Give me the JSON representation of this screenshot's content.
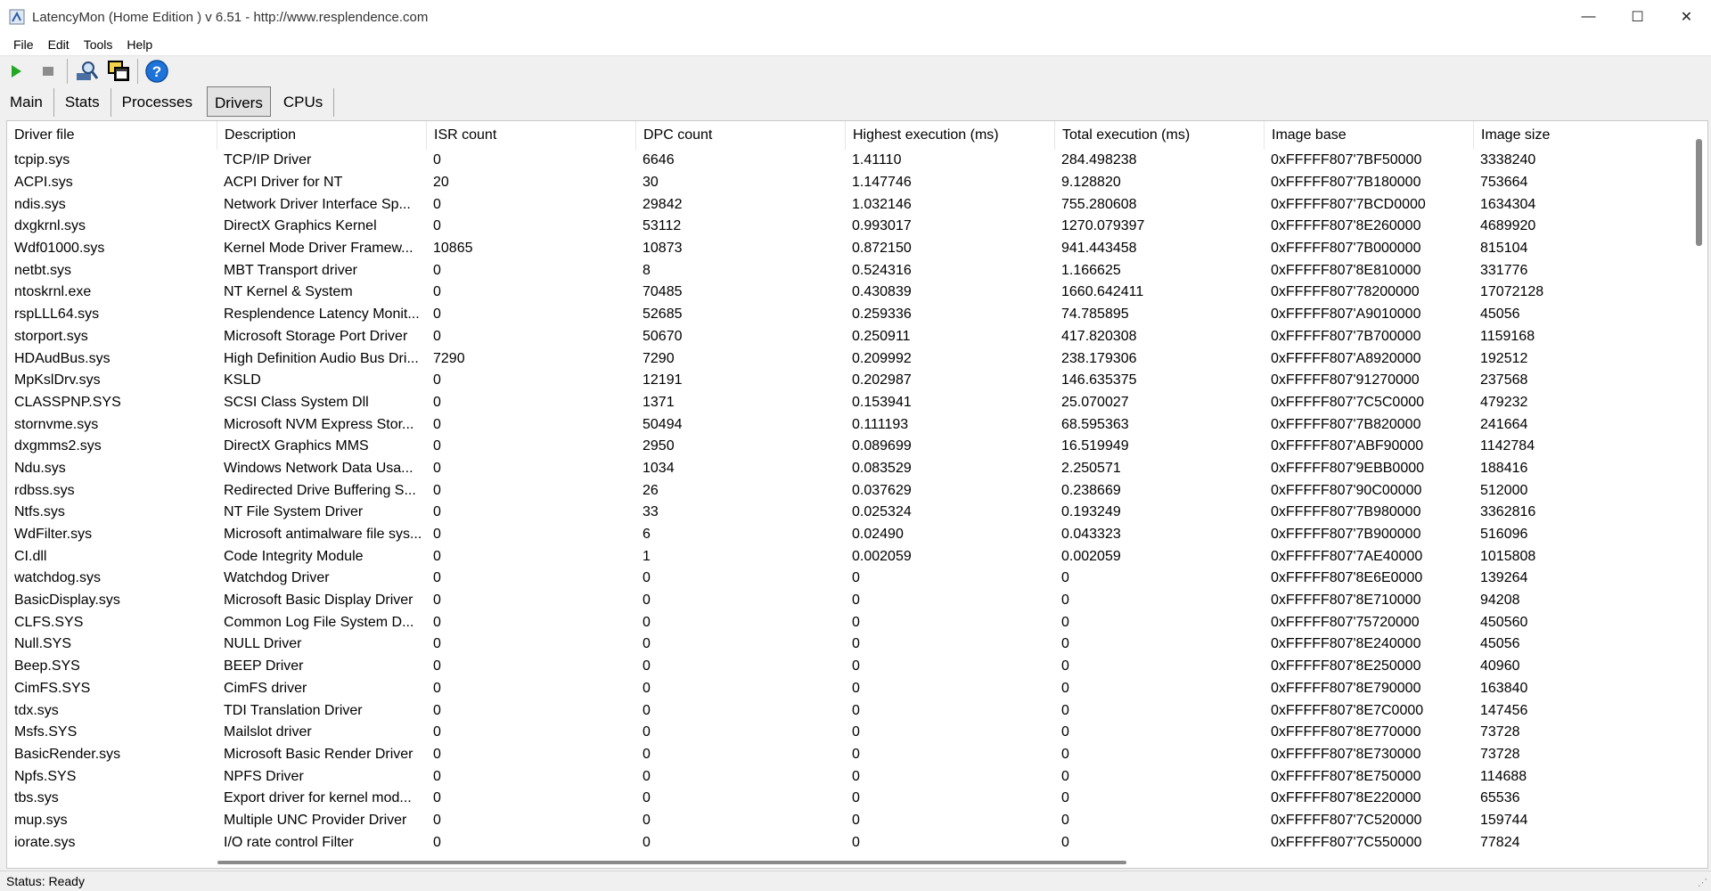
{
  "window": {
    "title": "LatencyMon  (Home Edition )  v 6.51 - http://www.resplendence.com",
    "minimize_glyph": "—",
    "maximize_glyph": "☐",
    "close_glyph": "✕"
  },
  "menu": [
    "File",
    "Edit",
    "Tools",
    "Help"
  ],
  "toolbar": {
    "icons": [
      "play-icon",
      "stop-icon",
      "search-icon",
      "windows-icon",
      "help-icon"
    ]
  },
  "tabs": [
    {
      "label": "Main",
      "active": false
    },
    {
      "label": "Stats",
      "active": false
    },
    {
      "label": "Processes",
      "active": false
    },
    {
      "label": "Drivers",
      "active": true
    },
    {
      "label": "CPUs",
      "active": false
    }
  ],
  "table": {
    "columns": [
      "Driver file",
      "Description",
      "ISR count",
      "DPC count",
      "Highest execution (ms)",
      "Total execution (ms)",
      "Image base",
      "Image size"
    ],
    "rows": [
      [
        "tcpip.sys",
        "TCP/IP Driver",
        "0",
        "6646",
        "1.41110",
        "284.498238",
        "0xFFFFF807'7BF50000",
        "3338240"
      ],
      [
        "ACPI.sys",
        "ACPI Driver for NT",
        "20",
        "30",
        "1.147746",
        "9.128820",
        "0xFFFFF807'7B180000",
        "753664"
      ],
      [
        "ndis.sys",
        "Network Driver Interface Sp...",
        "0",
        "29842",
        "1.032146",
        "755.280608",
        "0xFFFFF807'7BCD0000",
        "1634304"
      ],
      [
        "dxgkrnl.sys",
        "DirectX Graphics Kernel",
        "0",
        "53112",
        "0.993017",
        "1270.079397",
        "0xFFFFF807'8E260000",
        "4689920"
      ],
      [
        "Wdf01000.sys",
        "Kernel Mode Driver Framew...",
        "10865",
        "10873",
        "0.872150",
        "941.443458",
        "0xFFFFF807'7B000000",
        "815104"
      ],
      [
        "netbt.sys",
        "MBT Transport driver",
        "0",
        "8",
        "0.524316",
        "1.166625",
        "0xFFFFF807'8E810000",
        "331776"
      ],
      [
        "ntoskrnl.exe",
        "NT Kernel & System",
        "0",
        "70485",
        "0.430839",
        "1660.642411",
        "0xFFFFF807'78200000",
        "17072128"
      ],
      [
        "rspLLL64.sys",
        "Resplendence Latency Monit...",
        "0",
        "52685",
        "0.259336",
        "74.785895",
        "0xFFFFF807'A9010000",
        "45056"
      ],
      [
        "storport.sys",
        "Microsoft Storage Port Driver",
        "0",
        "50670",
        "0.250911",
        "417.820308",
        "0xFFFFF807'7B700000",
        "1159168"
      ],
      [
        "HDAudBus.sys",
        "High Definition Audio Bus Dri...",
        "7290",
        "7290",
        "0.209992",
        "238.179306",
        "0xFFFFF807'A8920000",
        "192512"
      ],
      [
        "MpKslDrv.sys",
        "KSLD",
        "0",
        "12191",
        "0.202987",
        "146.635375",
        "0xFFFFF807'91270000",
        "237568"
      ],
      [
        "CLASSPNP.SYS",
        "SCSI Class System Dll",
        "0",
        "1371",
        "0.153941",
        "25.070027",
        "0xFFFFF807'7C5C0000",
        "479232"
      ],
      [
        "stornvme.sys",
        "Microsoft NVM Express Stor...",
        "0",
        "50494",
        "0.111193",
        "68.595363",
        "0xFFFFF807'7B820000",
        "241664"
      ],
      [
        "dxgmms2.sys",
        "DirectX Graphics MMS",
        "0",
        "2950",
        "0.089699",
        "16.519949",
        "0xFFFFF807'ABF90000",
        "1142784"
      ],
      [
        "Ndu.sys",
        "Windows Network Data Usa...",
        "0",
        "1034",
        "0.083529",
        "2.250571",
        "0xFFFFF807'9EBB0000",
        "188416"
      ],
      [
        "rdbss.sys",
        "Redirected Drive Buffering S...",
        "0",
        "26",
        "0.037629",
        "0.238669",
        "0xFFFFF807'90C00000",
        "512000"
      ],
      [
        "Ntfs.sys",
        "NT File System Driver",
        "0",
        "33",
        "0.025324",
        "0.193249",
        "0xFFFFF807'7B980000",
        "3362816"
      ],
      [
        "WdFilter.sys",
        "Microsoft antimalware file sys...",
        "0",
        "6",
        "0.02490",
        "0.043323",
        "0xFFFFF807'7B900000",
        "516096"
      ],
      [
        "CI.dll",
        "Code Integrity Module",
        "0",
        "1",
        "0.002059",
        "0.002059",
        "0xFFFFF807'7AE40000",
        "1015808"
      ],
      [
        "watchdog.sys",
        "Watchdog Driver",
        "0",
        "0",
        "0",
        "0",
        "0xFFFFF807'8E6E0000",
        "139264"
      ],
      [
        "BasicDisplay.sys",
        "Microsoft Basic Display Driver",
        "0",
        "0",
        "0",
        "0",
        "0xFFFFF807'8E710000",
        "94208"
      ],
      [
        "CLFS.SYS",
        "Common Log File System D...",
        "0",
        "0",
        "0",
        "0",
        "0xFFFFF807'75720000",
        "450560"
      ],
      [
        "Null.SYS",
        "NULL Driver",
        "0",
        "0",
        "0",
        "0",
        "0xFFFFF807'8E240000",
        "45056"
      ],
      [
        "Beep.SYS",
        "BEEP Driver",
        "0",
        "0",
        "0",
        "0",
        "0xFFFFF807'8E250000",
        "40960"
      ],
      [
        "CimFS.SYS",
        "CimFS driver",
        "0",
        "0",
        "0",
        "0",
        "0xFFFFF807'8E790000",
        "163840"
      ],
      [
        "tdx.sys",
        "TDI Translation Driver",
        "0",
        "0",
        "0",
        "0",
        "0xFFFFF807'8E7C0000",
        "147456"
      ],
      [
        "Msfs.SYS",
        "Mailslot driver",
        "0",
        "0",
        "0",
        "0",
        "0xFFFFF807'8E770000",
        "73728"
      ],
      [
        "BasicRender.sys",
        "Microsoft Basic Render Driver",
        "0",
        "0",
        "0",
        "0",
        "0xFFFFF807'8E730000",
        "73728"
      ],
      [
        "Npfs.SYS",
        "NPFS Driver",
        "0",
        "0",
        "0",
        "0",
        "0xFFFFF807'8E750000",
        "114688"
      ],
      [
        "tbs.sys",
        "Export driver for kernel mod...",
        "0",
        "0",
        "0",
        "0",
        "0xFFFFF807'8E220000",
        "65536"
      ],
      [
        "mup.sys",
        "Multiple UNC Provider Driver",
        "0",
        "0",
        "0",
        "0",
        "0xFFFFF807'7C520000",
        "159744"
      ],
      [
        "iorate.sys",
        "I/O rate control Filter",
        "0",
        "0",
        "0",
        "0",
        "0xFFFFF807'7C550000",
        "77824"
      ]
    ]
  },
  "status": "Status: Ready",
  "colors": {
    "play": "#22a822",
    "help": "#1e73d8"
  }
}
